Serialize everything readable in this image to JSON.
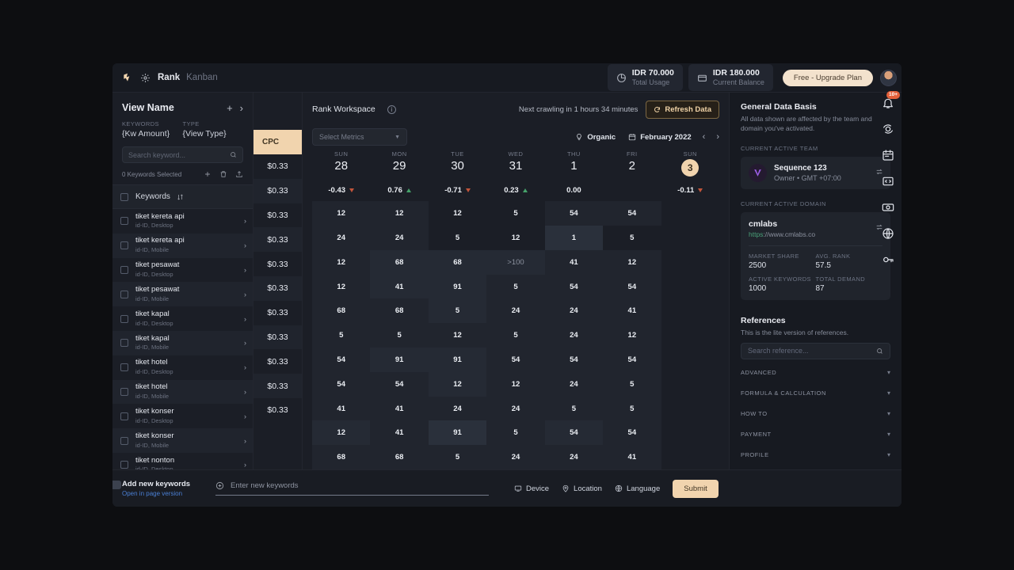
{
  "topbar": {
    "logo_icon": "bird-logo-icon",
    "gear_icon": "gear-icon",
    "breadcrumb_primary": "Rank",
    "breadcrumb_secondary": "Kanban",
    "stats": [
      {
        "icon": "pie-chart-icon",
        "value": "IDR 70.000",
        "label": "Total Usage"
      },
      {
        "icon": "wallet-icon",
        "value": "IDR 180.000",
        "label": "Current Balance"
      }
    ],
    "upgrade_label": "Free - Upgrade Plan",
    "avatar_name": "user-avatar"
  },
  "left_panel": {
    "title": "View Name",
    "add_icon": "plus-icon",
    "expand_icon": "chevron-right-icon",
    "meta": [
      {
        "key": "KEYWORDS",
        "value": "{Kw Amount}"
      },
      {
        "key": "TYPE",
        "value": "{View Type}"
      }
    ],
    "search_placeholder": "Search keyword...",
    "search_value": "",
    "selected_text": "0 Keywords Selected",
    "actions": [
      "plus-icon",
      "trash-icon",
      "export-icon"
    ],
    "column_header": "Keywords",
    "sort_icon": "sort-icon",
    "rows": [
      {
        "name": "tiket kereta api",
        "sub": "id-ID, Desktop"
      },
      {
        "name": "tiket kereta api",
        "sub": "id-ID, Mobile"
      },
      {
        "name": "tiket pesawat",
        "sub": "id-ID, Desktop"
      },
      {
        "name": "tiket pesawat",
        "sub": "id-ID, Mobile"
      },
      {
        "name": "tiket kapal",
        "sub": "id-ID, Desktop"
      },
      {
        "name": "tiket kapal",
        "sub": "id-ID, Mobile"
      },
      {
        "name": "tiket hotel",
        "sub": "id-ID, Desktop"
      },
      {
        "name": "tiket hotel",
        "sub": "id-ID, Mobile"
      },
      {
        "name": "tiket konser",
        "sub": "id-ID, Desktop"
      },
      {
        "name": "tiket konser",
        "sub": "id-ID, Mobile"
      },
      {
        "name": "tiket nonton",
        "sub": "id-ID, Desktop"
      }
    ]
  },
  "cpc_column": {
    "header": "CPC",
    "values": [
      "$0.33",
      "$0.33",
      "$0.33",
      "$0.33",
      "$0.33",
      "$0.33",
      "$0.33",
      "$0.33",
      "$0.33",
      "$0.33",
      "$0.33"
    ]
  },
  "grid": {
    "workspace_title": "Rank Workspace",
    "info_icon": "info-icon",
    "crawl_text": "Next crawling in 1 hours 34 minutes",
    "refresh_label": "Refresh Data",
    "refresh_icon": "refresh-icon",
    "metrics_placeholder": "Select Metrics",
    "chevron_icon": "chevron-down-icon",
    "organic_label": "Organic",
    "organic_icon": "bulb-icon",
    "month_label": "February 2022",
    "calendar_icon": "calendar-icon",
    "prev_icon": "chevron-left-icon",
    "next_icon": "chevron-right-icon"
  },
  "chart_data": {
    "type": "heatmap",
    "title": "Rank Workspace",
    "xlabel": "",
    "ylabel": "",
    "columns": [
      {
        "dow": "SUN",
        "day": "28",
        "active": false,
        "delta": "-0.43",
        "trend": "down"
      },
      {
        "dow": "MON",
        "day": "29",
        "active": false,
        "delta": "0.76",
        "trend": "up"
      },
      {
        "dow": "TUE",
        "day": "30",
        "active": false,
        "delta": "-0.71",
        "trend": "down"
      },
      {
        "dow": "WED",
        "day": "31",
        "active": false,
        "delta": "0.23",
        "trend": "up"
      },
      {
        "dow": "THU",
        "day": "1",
        "active": false,
        "delta": "0.00",
        "trend": "none"
      },
      {
        "dow": "FRI",
        "day": "2",
        "active": false,
        "delta": "",
        "trend": "none"
      },
      {
        "dow": "SUN",
        "day": "3",
        "active": true,
        "delta": "-0.11",
        "trend": "down"
      }
    ],
    "row_labels": [
      "tiket kereta api (Desktop)",
      "tiket kereta api (Mobile)",
      "tiket pesawat (Desktop)",
      "tiket pesawat (Mobile)",
      "tiket kapal (Desktop)",
      "tiket kapal (Mobile)",
      "tiket hotel (Desktop)",
      "tiket hotel (Mobile)",
      "tiket konser (Desktop)",
      "tiket konser (Mobile)",
      "tiket nonton (Desktop)"
    ],
    "rows": [
      [
        {
          "v": "12",
          "s": 1
        },
        {
          "v": "12",
          "s": 1
        },
        {
          "v": "12",
          "s": 0
        },
        {
          "v": "5",
          "s": 0
        },
        {
          "v": "54",
          "s": 1
        },
        {
          "v": "54",
          "s": 1
        },
        {
          "v": "",
          "s": 0
        }
      ],
      [
        {
          "v": "24",
          "s": 1
        },
        {
          "v": "24",
          "s": 1
        },
        {
          "v": "5",
          "s": 0
        },
        {
          "v": "12",
          "s": 0
        },
        {
          "v": "1",
          "s": 3
        },
        {
          "v": "5",
          "s": 0
        },
        {
          "v": "",
          "s": 0
        }
      ],
      [
        {
          "v": "12",
          "s": 1
        },
        {
          "v": "68",
          "s": 2
        },
        {
          "v": "68",
          "s": 2
        },
        {
          "v": ">100",
          "s": 2
        },
        {
          "v": "41",
          "s": 1
        },
        {
          "v": "12",
          "s": 1
        },
        {
          "v": "",
          "s": 0
        }
      ],
      [
        {
          "v": "12",
          "s": 1
        },
        {
          "v": "41",
          "s": 2
        },
        {
          "v": "91",
          "s": 2
        },
        {
          "v": "5",
          "s": 1
        },
        {
          "v": "54",
          "s": 1
        },
        {
          "v": "54",
          "s": 1
        },
        {
          "v": "",
          "s": 0
        }
      ],
      [
        {
          "v": "68",
          "s": 1
        },
        {
          "v": "68",
          "s": 1
        },
        {
          "v": "5",
          "s": 2
        },
        {
          "v": "24",
          "s": 1
        },
        {
          "v": "24",
          "s": 1
        },
        {
          "v": "41",
          "s": 1
        },
        {
          "v": "",
          "s": 0
        }
      ],
      [
        {
          "v": "5",
          "s": 1
        },
        {
          "v": "5",
          "s": 1
        },
        {
          "v": "12",
          "s": 1
        },
        {
          "v": "5",
          "s": 1
        },
        {
          "v": "24",
          "s": 1
        },
        {
          "v": "12",
          "s": 1
        },
        {
          "v": "",
          "s": 0
        }
      ],
      [
        {
          "v": "54",
          "s": 1
        },
        {
          "v": "91",
          "s": 2
        },
        {
          "v": "91",
          "s": 2
        },
        {
          "v": "54",
          "s": 1
        },
        {
          "v": "54",
          "s": 1
        },
        {
          "v": "54",
          "s": 1
        },
        {
          "v": "",
          "s": 0
        }
      ],
      [
        {
          "v": "54",
          "s": 1
        },
        {
          "v": "54",
          "s": 1
        },
        {
          "v": "12",
          "s": 2
        },
        {
          "v": "12",
          "s": 1
        },
        {
          "v": "24",
          "s": 1
        },
        {
          "v": "5",
          "s": 1
        },
        {
          "v": "",
          "s": 0
        }
      ],
      [
        {
          "v": "41",
          "s": 1
        },
        {
          "v": "41",
          "s": 1
        },
        {
          "v": "24",
          "s": 1
        },
        {
          "v": "24",
          "s": 1
        },
        {
          "v": "5",
          "s": 1
        },
        {
          "v": "5",
          "s": 1
        },
        {
          "v": "",
          "s": 0
        }
      ],
      [
        {
          "v": "12",
          "s": 2
        },
        {
          "v": "41",
          "s": 1
        },
        {
          "v": "91",
          "s": 3
        },
        {
          "v": "5",
          "s": 1
        },
        {
          "v": "54",
          "s": 2
        },
        {
          "v": "54",
          "s": 1
        },
        {
          "v": "",
          "s": 0
        }
      ],
      [
        {
          "v": "68",
          "s": 1
        },
        {
          "v": "68",
          "s": 1
        },
        {
          "v": "5",
          "s": 1
        },
        {
          "v": "24",
          "s": 1
        },
        {
          "v": "24",
          "s": 1
        },
        {
          "v": "41",
          "s": 1
        },
        {
          "v": "",
          "s": 0
        }
      ]
    ]
  },
  "bottom_bar": {
    "title": "Add new keywords",
    "link": "Open in page version",
    "input_placeholder": "Enter new keywords",
    "input_value": "",
    "add_icon": "plus-circle-icon",
    "options": [
      {
        "icon": "device-icon",
        "label": "Device"
      },
      {
        "icon": "location-icon",
        "label": "Location"
      },
      {
        "icon": "language-icon",
        "label": "Language"
      }
    ],
    "submit_label": "Submit"
  },
  "right_panel": {
    "heading": "General Data Basis",
    "sub": "All data shown are affected by the team and domain you've activated.",
    "team_label": "CURRENT ACTIVE TEAM",
    "team_name": "Sequence 123",
    "team_sub": "Owner • GMT +07:00",
    "switch_icon": "switch-icon",
    "domain_label": "CURRENT ACTIVE DOMAIN",
    "domain_name": "cmlabs",
    "domain_url_scheme": "https",
    "domain_url_rest": "://www.cmlabs.co",
    "domain_stats": [
      {
        "key": "MARKET SHARE",
        "value": "2500"
      },
      {
        "key": "AVG. RANK",
        "value": "57.5"
      },
      {
        "key": "ACTIVE KEYWORDS",
        "value": "1000"
      },
      {
        "key": "TOTAL DEMAND",
        "value": "87"
      }
    ],
    "references_heading": "References",
    "references_sub": "This is the lite version of references.",
    "references_search_placeholder": "Search reference...",
    "references_search_value": "",
    "accordions": [
      "ADVANCED",
      "FORMULA & CALCULATION",
      "HOW TO",
      "PAYMENT",
      "PROFILE"
    ]
  },
  "icon_rail": [
    {
      "name": "bell-icon",
      "badge": "10+"
    },
    {
      "name": "sync-icon",
      "badge": ""
    },
    {
      "name": "calendar-icon",
      "badge": ""
    },
    {
      "name": "code-icon",
      "badge": ""
    },
    {
      "name": "money-icon",
      "badge": ""
    },
    {
      "name": "globe-icon",
      "badge": ""
    },
    {
      "name": "key-icon",
      "badge": ""
    }
  ],
  "colors": {
    "accent": "#f1d4ae",
    "app_bg": "#1b1e26",
    "page_bg": "#0d0e11",
    "up": "#46a26a",
    "down": "#c2553b",
    "link": "#4a7fd4"
  }
}
